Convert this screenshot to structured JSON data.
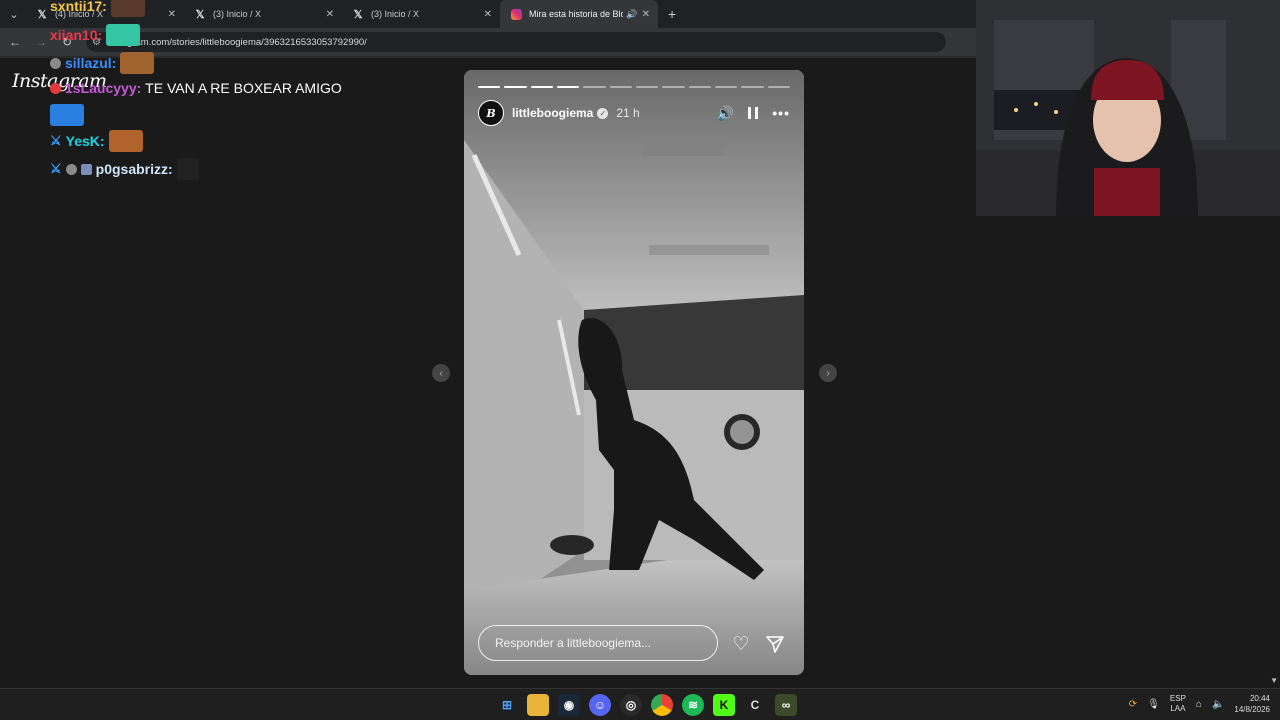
{
  "browser": {
    "tabs": [
      {
        "title": "(4) Inicio / X",
        "icon": "x-logo-icon"
      },
      {
        "title": "(3) Inicio / X",
        "icon": "x-logo-icon"
      },
      {
        "title": "(3) Inicio / X",
        "icon": "x-logo-icon"
      },
      {
        "title": "Mira esta historia de Blockchain",
        "icon": "instagram-icon",
        "active": true
      }
    ],
    "address": "instagram.com/stories/littleboogiema/3963216533053792990/"
  },
  "instagram": {
    "logo": "Instagram",
    "story": {
      "username": "littleboogiema",
      "time_ago": "21 h",
      "reply_placeholder": "Responder a littleboogiema...",
      "segments_total": 12,
      "segments_seen": 4
    }
  },
  "chat": [
    {
      "user": "sxntii17",
      "color": "#f3c74a",
      "text": ""
    },
    {
      "user": "xiian10",
      "color": "#e8394a",
      "text": ""
    },
    {
      "user": "sillazul",
      "color": "#3b8fff",
      "text": ""
    },
    {
      "user": "1sLaucyyy",
      "color": "#c65bd6",
      "text": "TE VAN A RE BOXEAR AMIGO"
    },
    {
      "user": "YesK",
      "color": "#19d4e4",
      "text": ""
    },
    {
      "user": "p0gsabrizz",
      "color": "#cfe4f6",
      "text": ""
    }
  ],
  "taskbar": {
    "icons": [
      "windows-start-icon",
      "file-explorer-icon",
      "steam-icon",
      "discord-icon",
      "obs-icon",
      "chrome-icon",
      "spotify-icon",
      "kick-icon",
      "ccleaner-icon",
      "app-icon"
    ],
    "lang_line1": "ESP",
    "lang_line2": "LAA",
    "time": "20:44",
    "date": "14/8/2026"
  },
  "colors": {
    "page_bg": "#1a1a1a",
    "tab_bg": "#202124",
    "toolbar_bg": "#35363a"
  }
}
